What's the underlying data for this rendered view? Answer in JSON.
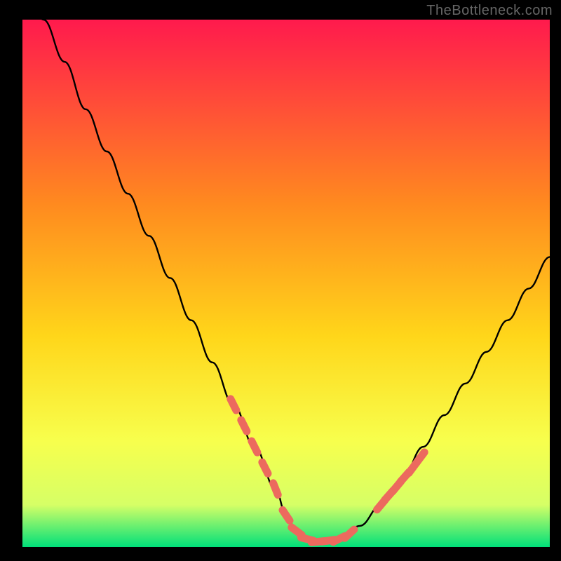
{
  "watermark": "TheBottleneck.com",
  "colors": {
    "bg_black": "#000000",
    "grad_top": "#ff1a4d",
    "grad_mid1": "#ff8a1f",
    "grad_mid2": "#ffd61a",
    "grad_mid3": "#f7ff4d",
    "grad_low": "#d6ff66",
    "grad_bottom": "#00e07a",
    "curve": "#000000",
    "marker_fill": "#ec6a5e",
    "marker_stroke": "#c84f46",
    "watermark": "#666666"
  },
  "chart_data": {
    "type": "line",
    "title": "",
    "xlabel": "",
    "ylabel": "",
    "ylim": [
      0,
      100
    ],
    "xlim": [
      0,
      100
    ],
    "series": [
      {
        "name": "bottleneck-curve",
        "x": [
          0,
          4,
          8,
          12,
          16,
          20,
          24,
          28,
          32,
          36,
          40,
          44,
          48,
          50,
          52,
          54,
          56,
          60,
          64,
          68,
          72,
          76,
          80,
          84,
          88,
          92,
          96,
          100
        ],
        "y": [
          108,
          100,
          92,
          83,
          75,
          67,
          59,
          51,
          43,
          35,
          27,
          19,
          11,
          6,
          3,
          1.5,
          1,
          1.5,
          4,
          8,
          13,
          19,
          25,
          31,
          37,
          43,
          49,
          55
        ]
      }
    ],
    "markers": {
      "name": "highlight-band",
      "x": [
        40,
        42,
        44,
        46,
        48,
        50,
        52,
        54,
        56,
        58,
        60,
        62,
        68,
        69.5,
        71,
        72.5,
        74,
        75.5
      ],
      "y": [
        27,
        23,
        19,
        15,
        11,
        6,
        3,
        1.5,
        1,
        1.2,
        1.5,
        2.5,
        8,
        9.8,
        11.5,
        13.3,
        15,
        17
      ]
    }
  }
}
